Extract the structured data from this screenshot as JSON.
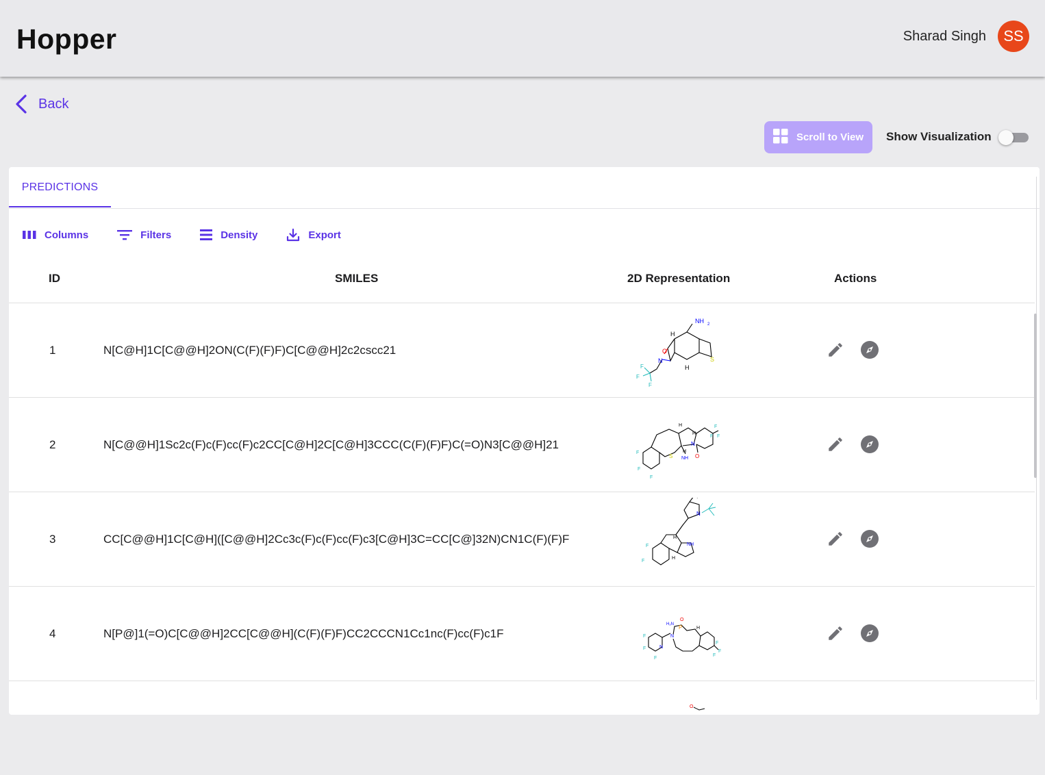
{
  "app": {
    "title": "Hopper"
  },
  "user": {
    "name": "Sharad Singh",
    "initials": "SS"
  },
  "nav": {
    "back_label": "Back"
  },
  "controls": {
    "scroll_to_view_label": "Scroll to View",
    "show_visualization_label": "Show Visualization",
    "show_visualization_on": false
  },
  "tabs": [
    {
      "label": "PREDICTIONS",
      "active": true
    }
  ],
  "toolbar": {
    "columns_label": "Columns",
    "filters_label": "Filters",
    "density_label": "Density",
    "export_label": "Export"
  },
  "table": {
    "headers": {
      "id": "ID",
      "smiles": "SMILES",
      "representation": "2D Representation",
      "actions": "Actions"
    },
    "rows": [
      {
        "id": "1",
        "smiles": "N[C@H]1C[C@@H]2ON(C(F)(F)F)C[C@@H]2c2cscc21"
      },
      {
        "id": "2",
        "smiles": "N[C@@H]1Sc2c(F)c(F)cc(F)c2CC[C@H]2C[C@H]3CCC(C(F)(F)F)C(=O)N3[C@@H]21"
      },
      {
        "id": "3",
        "smiles": "CC[C@@H]1C[C@H]([C@@H]2Cc3c(F)c(F)cc(F)c3[C@H]3C=CC[C@]32N)CN1C(F)(F)F"
      },
      {
        "id": "4",
        "smiles": "N[P@]1(=O)C[C@@H]2CC[C@@H](C(F)(F)F)CC2CCCN1Cc1nc(F)cc(F)c1F"
      }
    ]
  },
  "colors": {
    "accent": "#5a33e6",
    "avatar": "#e8471a",
    "scroll_button": "#b8a4fa"
  },
  "icons": {
    "back": "chevron-left-icon",
    "scroll": "grid-icon",
    "edit": "pencil-icon",
    "explore": "compass-icon"
  }
}
